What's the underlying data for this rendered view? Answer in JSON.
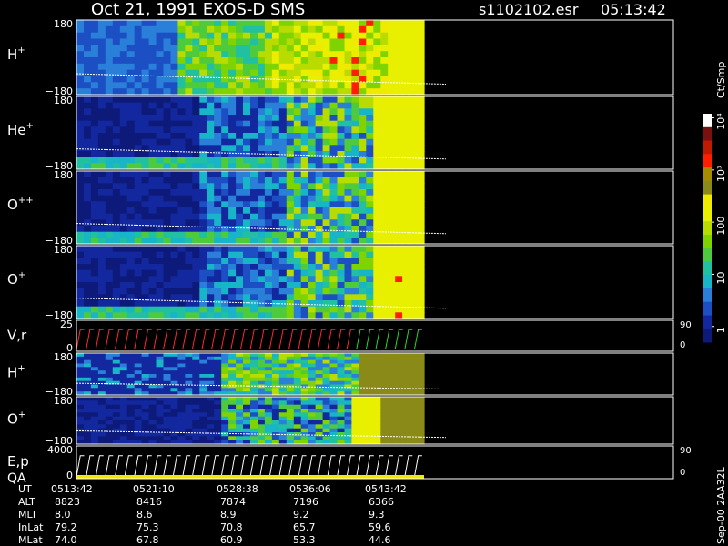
{
  "header": {
    "title": "Oct 21, 1991   EXOS-D SMS",
    "file": "s1102102.esr",
    "time": "05:13:42"
  },
  "footer_id": "Sep-00  2AA32L",
  "colorbar": {
    "unit": "Ct/Smp",
    "ticks": [
      {
        "v": 1,
        "label": "1"
      },
      {
        "v": 10,
        "label": "10"
      },
      {
        "v": 100,
        "label": "100"
      },
      {
        "v": 1000,
        "label": "10³"
      },
      {
        "v": 10000,
        "label": "10⁴"
      }
    ],
    "range": [
      0.5,
      12000
    ],
    "colors": [
      "#0d1a7a",
      "#13289e",
      "#1c4fc4",
      "#2a80d8",
      "#18b4c8",
      "#20c0a0",
      "#4ecb3c",
      "#7fd400",
      "#b8dc00",
      "#e8f000",
      "#f0ea00",
      "#8a8a18",
      "#a58c00",
      "#ff1e00",
      "#c01a00",
      "#7a1010",
      "#ffffff"
    ]
  },
  "chart_data": {
    "type": "heatmap",
    "time_axis": {
      "labels": [
        "0513:42",
        "0521:10",
        "0528:38",
        "0536:06",
        "0543:42"
      ],
      "ephemeris": [
        {
          "name": "UT",
          "values": [
            "0513:42",
            "0521:10",
            "0528:38",
            "0536:06",
            "0543:42"
          ]
        },
        {
          "name": "ALT",
          "values": [
            "8823",
            "8416",
            "7874",
            "7196",
            "6366"
          ]
        },
        {
          "name": "MLT",
          "values": [
            "8.0",
            "8.6",
            "8.9",
            "9.2",
            "9.3"
          ]
        },
        {
          "name": "InLat",
          "values": [
            "79.2",
            "75.3",
            "70.8",
            "65.7",
            "59.6"
          ]
        },
        {
          "name": "MLat",
          "values": [
            "74.0",
            "67.8",
            "60.9",
            "53.3",
            "44.6"
          ]
        }
      ]
    },
    "panels": [
      {
        "name": "H",
        "ion_sup": "+",
        "type": "heatmap",
        "yrange": [
          -180,
          180
        ],
        "ylabels": [
          "180",
          "−180"
        ]
      },
      {
        "name": "He",
        "ion_sup": "+",
        "type": "heatmap",
        "yrange": [
          -180,
          180
        ],
        "ylabels": [
          "180",
          "−180"
        ]
      },
      {
        "name": "O",
        "ion_sup": "++",
        "type": "heatmap",
        "yrange": [
          -180,
          180
        ],
        "ylabels": [
          "180",
          "−180"
        ]
      },
      {
        "name": "O",
        "ion_sup": "+",
        "type": "heatmap",
        "yrange": [
          -180,
          180
        ],
        "ylabels": [
          "180",
          "−180"
        ]
      },
      {
        "name": "V,r",
        "ion_sup": "",
        "type": "line",
        "yrange": [
          0,
          25
        ],
        "ylabels": [
          "25",
          "0"
        ],
        "right_labels": [
          "90",
          "0"
        ]
      },
      {
        "name": "H",
        "ion_sup": "+",
        "type": "heatmap",
        "yrange": [
          -180,
          180
        ],
        "ylabels": [
          "180",
          "−180"
        ]
      },
      {
        "name": "O",
        "ion_sup": "+",
        "type": "heatmap",
        "yrange": [
          -180,
          180
        ],
        "ylabels": [
          "180",
          "−180"
        ]
      },
      {
        "name": "E,p",
        "name2": "QA",
        "ion_sup": "",
        "type": "line",
        "yrange": [
          0,
          4000
        ],
        "ylabels": [
          "4000",
          "0"
        ],
        "right_labels": [
          "90",
          "0"
        ]
      }
    ]
  }
}
